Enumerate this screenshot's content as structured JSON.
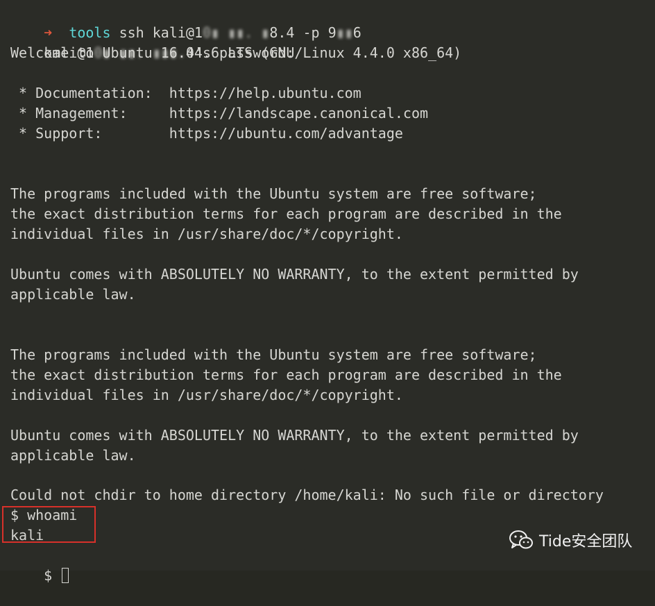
{
  "terminal": {
    "prompt_arrow": "➜",
    "prompt_cwd": "tools",
    "ssh_cmd_pre": " ssh kali@1",
    "ssh_cmd_blur1": "0▮ ▮▮. ▮",
    "ssh_cmd_mid": "8.4 -p 9",
    "ssh_cmd_blur2": "▮▮",
    "ssh_cmd_post": "6",
    "pw_pre": "kali@1",
    "pw_blur": "0▮ ▮▮. ▮▮▮.",
    "pw_post": "4's password:",
    "welcome": "Welcome to Ubuntu 16.04.6 LTS (GNU/Linux 4.4.0 x86_64)",
    "doc_line": " * Documentation:  https://help.ubuntu.com",
    "mgmt_line": " * Management:     https://landscape.canonical.com",
    "support_line": " * Support:        https://ubuntu.com/advantage",
    "free_sw_1": "The programs included with the Ubuntu system are free software;",
    "free_sw_2": "the exact distribution terms for each program are described in the",
    "free_sw_3": "individual files in /usr/share/doc/*/copyright.",
    "warranty_1": "Ubuntu comes with ABSOLUTELY NO WARRANTY, to the extent permitted by",
    "warranty_2": "applicable law.",
    "chdir_error": "Could not chdir to home directory /home/kali: No such file or directory",
    "whoami_cmd": "$ whoami",
    "whoami_output": "kali",
    "final_prompt": "$ "
  },
  "watermark": {
    "text": "Tide安全团队",
    "icon": "wechat-icon"
  }
}
